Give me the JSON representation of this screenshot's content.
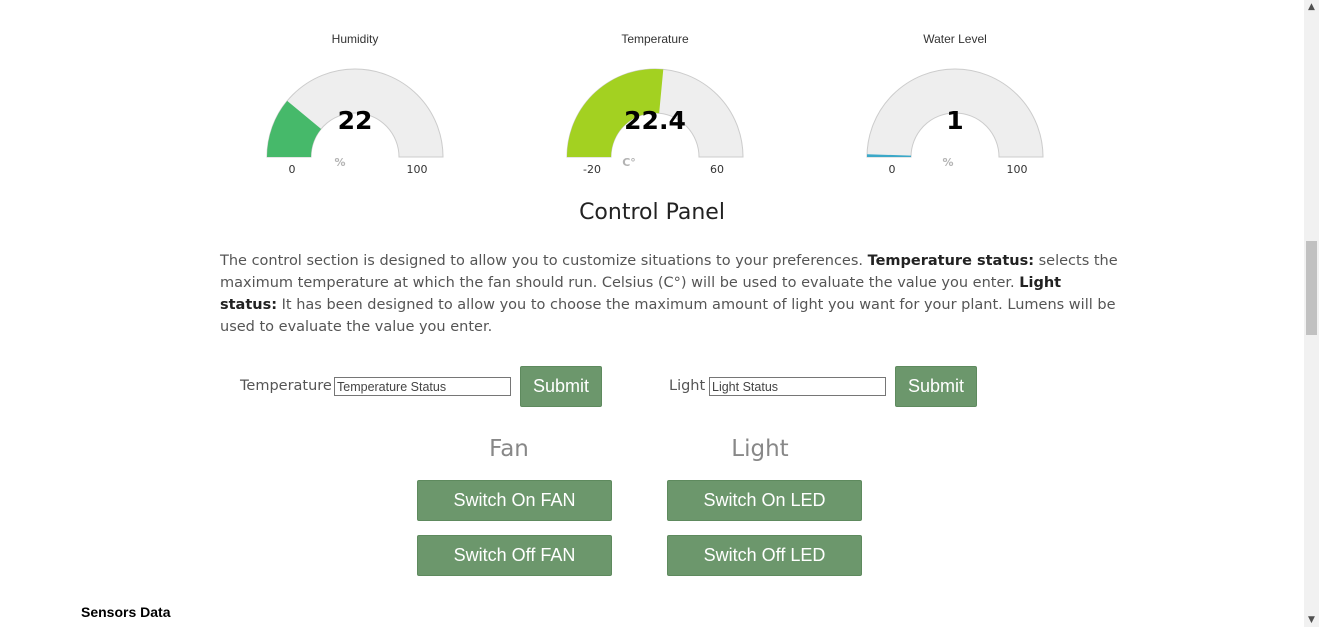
{
  "gauges": [
    {
      "title": "Humidity",
      "value": "22",
      "numeric": 22,
      "min": "0",
      "max": "100",
      "min_num": 0,
      "max_num": 100,
      "unit": "%",
      "color": "#46b96a"
    },
    {
      "title": "Temperature",
      "value": "22.4",
      "numeric": 22.4,
      "min": "-20",
      "max": "60",
      "min_num": -20,
      "max_num": 60,
      "unit": "C°",
      "color": "#a3d121"
    },
    {
      "title": "Water Level",
      "value": "1",
      "numeric": 1,
      "min": "0",
      "max": "100",
      "min_num": 0,
      "max_num": 100,
      "unit": "%",
      "color": "#3ba8c8"
    }
  ],
  "control_panel": {
    "title": "Control Panel",
    "description": {
      "intro": "The control section is designed to allow you to customize situations to your preferences. ",
      "temp_label": "Temperature status:",
      "temp_text": " selects the maximum temperature at which the fan should run. Celsius (C°) will be used to evaluate the value you enter. ",
      "light_label": "Light status:",
      "light_text": " It has been designed to allow you to choose the maximum amount of light you want for your plant. Lumens will be used to evaluate the value you enter."
    },
    "temperature_form": {
      "label": "Temperature",
      "placeholder": "Temperature Status",
      "submit": "Submit"
    },
    "light_form": {
      "label": "Light",
      "placeholder": "Light Status",
      "submit": "Submit"
    },
    "fan": {
      "heading": "Fan",
      "on_label": "Switch On FAN",
      "off_label": "Switch Off FAN"
    },
    "light": {
      "heading": "Light",
      "on_label": "Switch On LED",
      "off_label": "Switch Off LED"
    }
  },
  "sensors_data_label": "Sensors Data",
  "colors": {
    "button": "#6c976c",
    "gauge_track": "#eeeeee"
  }
}
